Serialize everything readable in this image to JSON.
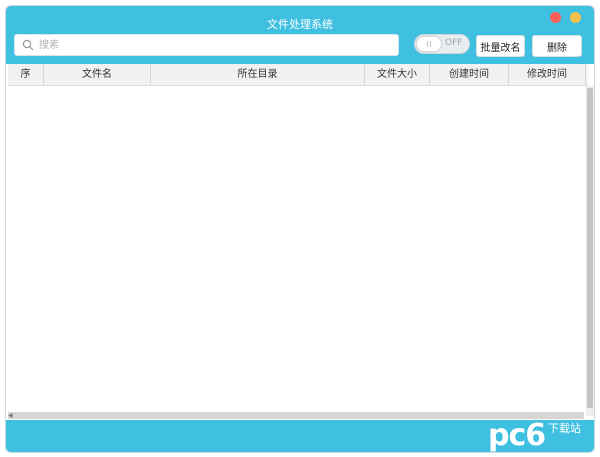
{
  "window": {
    "title": "文件处理系统"
  },
  "toolbar": {
    "search_placeholder": "搜索",
    "toggle_label": "OFF",
    "batch_rename_label": "批量改名",
    "delete_label": "删除"
  },
  "table": {
    "columns": [
      "序",
      "文件名",
      "所在目录",
      "文件大小",
      "创建时间",
      "修改时间"
    ],
    "rows": []
  },
  "watermark": {
    "mark": "pc6",
    "sub": "下载站"
  },
  "colors": {
    "accent": "#40c0e0",
    "close": "#ff6057",
    "minimize": "#f5c14a"
  }
}
